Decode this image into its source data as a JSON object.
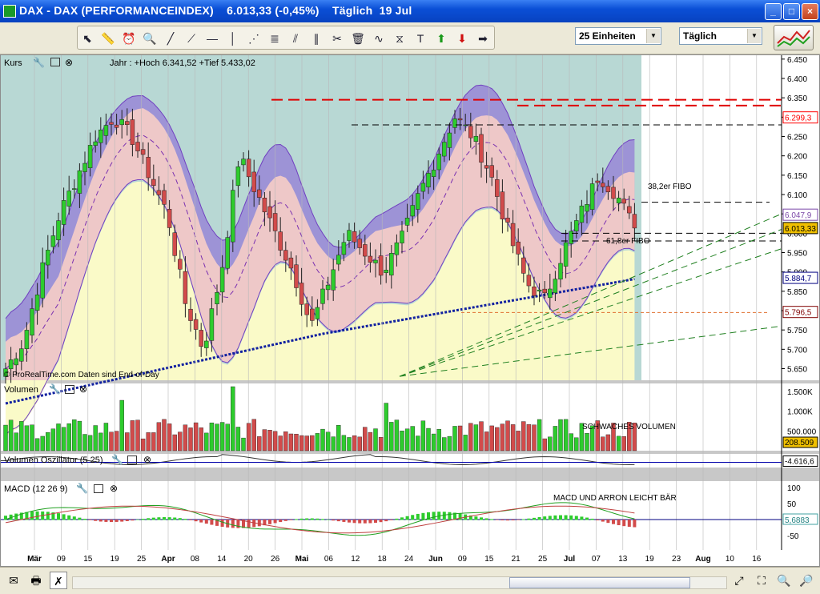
{
  "window": {
    "title": "DAX - DAX (PERFORMANCEINDEX)    6.013,33 (-0,45%)    Täglich  19 Jul",
    "minimize": "_",
    "maximize": "□",
    "close": "×"
  },
  "toolbar": {
    "units_select": "25 Einheiten",
    "period_select": "Täglich"
  },
  "price_panel": {
    "label": "Kurs",
    "info": "Jahr : +Hoch 6.341,52 +Tief 5.433,02",
    "watermark": "© ProRealTime.com  Daten sind End-of-Day",
    "fibo_38": "38,2er FIBO",
    "fibo_61": "61,8er FIBO",
    "axis_ticks": [
      "6.450",
      "6.400",
      "6.350",
      "6.300",
      "6.250",
      "6.200",
      "6.150",
      "6.100",
      "6.050",
      "6.000",
      "5.950",
      "5.900",
      "5.850",
      "5.800",
      "5.750",
      "5.700",
      "5.650"
    ],
    "value_tags": [
      {
        "label": "6.299,3",
        "value": 6299.3,
        "color": "#ff0000",
        "fill": "#ffffff"
      },
      {
        "label": "6.047,9",
        "value": 6047.9,
        "color": "#7b48a8",
        "fill": "#ffffff"
      },
      {
        "label": "6.013,33",
        "value": 6013.33,
        "color": "#000000",
        "fill": "#f0c000"
      },
      {
        "label": "5.884,7",
        "value": 5884.7,
        "color": "#000080",
        "fill": "#ffffff"
      },
      {
        "label": "5.796,5",
        "value": 5796.5,
        "color": "#800000",
        "fill": "#ffffff"
      }
    ]
  },
  "volume_panel": {
    "label": "Volumen",
    "note": "SCHWACHES VOLUMEN",
    "axis_ticks": [
      "1.500K",
      "1.000K",
      "500.000"
    ],
    "last_tag": "208.509"
  },
  "volosc_panel": {
    "label": "Volumen Oszillator (5 25)",
    "last_tag": "-4.616,6"
  },
  "macd_panel": {
    "label": "MACD (12 26 9)",
    "note": "MACD UND ARRON LEICHT BÄR",
    "axis_ticks": [
      "100",
      "50",
      "0",
      "-50"
    ],
    "last_tag": "5,6883"
  },
  "x_axis": [
    {
      "label": "Mär",
      "bold": true
    },
    {
      "label": "09"
    },
    {
      "label": "15"
    },
    {
      "label": "19"
    },
    {
      "label": "25"
    },
    {
      "label": "Apr",
      "bold": true
    },
    {
      "label": "08"
    },
    {
      "label": "14"
    },
    {
      "label": "20"
    },
    {
      "label": "26"
    },
    {
      "label": "Mai",
      "bold": true
    },
    {
      "label": "06"
    },
    {
      "label": "12"
    },
    {
      "label": "18"
    },
    {
      "label": "24"
    },
    {
      "label": "Jun",
      "bold": true
    },
    {
      "label": "09"
    },
    {
      "label": "15"
    },
    {
      "label": "21"
    },
    {
      "label": "25"
    },
    {
      "label": "Jul",
      "bold": true
    },
    {
      "label": "07"
    },
    {
      "label": "13"
    },
    {
      "label": "19"
    },
    {
      "label": "23"
    },
    {
      "label": "Aug",
      "bold": true
    },
    {
      "label": "10"
    },
    {
      "label": "16"
    }
  ],
  "colors": {
    "up": "#2dcc2d",
    "down": "#d24b4b",
    "bb_fill": "#9a8cd6",
    "band_pink": "#eec8c8",
    "band_yellow": "#fafac8",
    "bg_teal": "#b8d8d4"
  }
}
